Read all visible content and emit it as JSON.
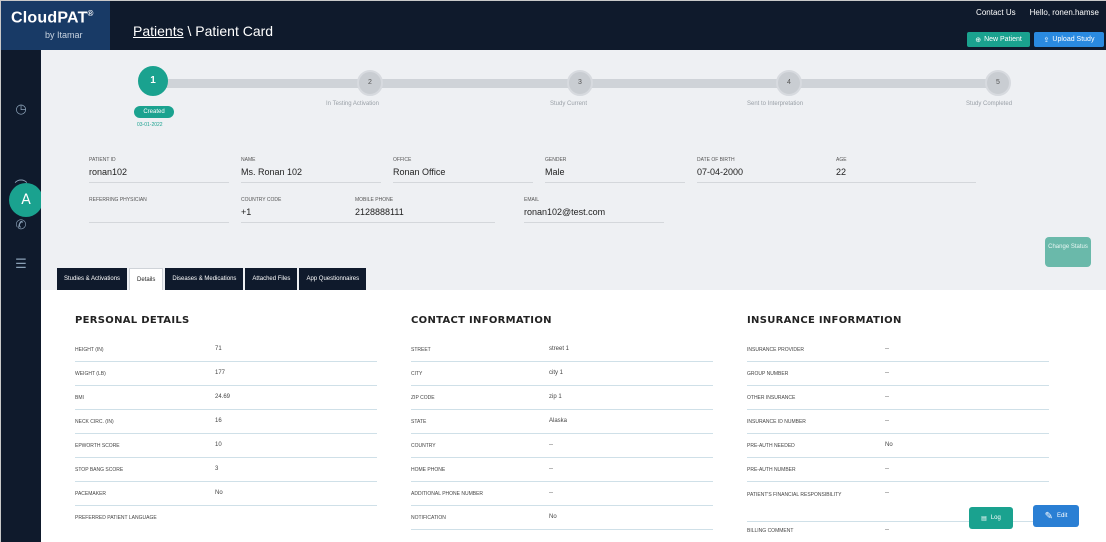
{
  "app": {
    "logo": "CloudPAT",
    "logo_mark": "®",
    "logo_sub": "by Itamar"
  },
  "topbar": {
    "breadcrumb_link": "Patients",
    "breadcrumb_sep": " \\ ",
    "breadcrumb_current": "Patient Card",
    "contact_us": "Contact Us",
    "greeting": "Hello, ronen.hamse",
    "new_patient_label": "New Patient",
    "upload_study_label": "Upload Study"
  },
  "sidebar": {
    "icons": [
      "clock-icon",
      "patient-icon",
      "device-icon",
      "phone-icon",
      "menu-icon"
    ],
    "active_label": "A"
  },
  "stepper": {
    "steps": [
      {
        "number": "1",
        "label": "Created",
        "date": "03-01-2022"
      },
      {
        "number": "2",
        "label": "In Testing Activation"
      },
      {
        "number": "3",
        "label": "Study Current"
      },
      {
        "number": "4",
        "label": "Sent to Interpretation"
      },
      {
        "number": "5",
        "label": "Study Completed"
      }
    ]
  },
  "patient": {
    "fields": [
      {
        "label": "Patient ID",
        "value": "ronan102"
      },
      {
        "label": "Name",
        "value": "Ms. Ronan 102"
      },
      {
        "label": "Office",
        "value": "Ronan Office"
      },
      {
        "label": "Gender",
        "value": "Male"
      },
      {
        "label": "Date of Birth",
        "value": "07-04-2000"
      },
      {
        "label": "Age",
        "value": "22"
      },
      {
        "label": "Referring Physician",
        "value": ""
      },
      {
        "label": "Country Code",
        "value": "+1"
      },
      {
        "label": "Mobile Phone",
        "value": "2128888111"
      },
      {
        "label": "Email",
        "value": "ronan102@test.com"
      }
    ],
    "status_button": "Change Status"
  },
  "tabs": [
    {
      "label": "Studies & Activations",
      "active": false
    },
    {
      "label": "Details",
      "active": true
    },
    {
      "label": "Diseases & Medications",
      "active": false
    },
    {
      "label": "Attached Files",
      "active": false
    },
    {
      "label": "App Questionnaires",
      "active": false
    }
  ],
  "personal_details": {
    "title": "PERSONAL DETAILS",
    "rows": [
      {
        "label": "Height (in)",
        "value": "71"
      },
      {
        "label": "Weight (lb)",
        "value": "177"
      },
      {
        "label": "BMI",
        "value": "24.69"
      },
      {
        "label": "Neck Circ. (in)",
        "value": "16"
      },
      {
        "label": "Epworth Score",
        "value": "10"
      },
      {
        "label": "Stop Bang Score",
        "value": "3"
      },
      {
        "label": "Pacemaker",
        "value": "No"
      },
      {
        "label": "Preferred Patient Language",
        "value": ""
      }
    ]
  },
  "contact_information": {
    "title": "CONTACT INFORMATION",
    "rows": [
      {
        "label": "Street",
        "value": "street 1"
      },
      {
        "label": "City",
        "value": "city 1"
      },
      {
        "label": "Zip Code",
        "value": "zip 1"
      },
      {
        "label": "State",
        "value": "Alaska"
      },
      {
        "label": "Country",
        "value": "--"
      },
      {
        "label": "Home Phone",
        "value": "--"
      },
      {
        "label": "Additional Phone Number",
        "value": "--"
      },
      {
        "label": "Notification",
        "value": "No"
      }
    ]
  },
  "insurance_information": {
    "title": "INSURANCE INFORMATION",
    "rows": [
      {
        "label": "Insurance Provider",
        "value": "--"
      },
      {
        "label": "Group Number",
        "value": "--"
      },
      {
        "label": "Other Insurance",
        "value": "--"
      },
      {
        "label": "Insurance ID Number",
        "value": "--"
      },
      {
        "label": "Pre-Auth Needed",
        "value": "No"
      },
      {
        "label": "Pre-Auth Number",
        "value": "--"
      },
      {
        "label": "Patient's Financial Responsibility",
        "value": "--"
      },
      {
        "label": "Billing Comment",
        "value": "--"
      }
    ]
  },
  "actions": {
    "log_label": "Log",
    "edit_label": "Edit"
  },
  "colors": {
    "primary_teal": "#1aa28f",
    "nav_dark": "#0f1a2c",
    "accent_blue": "#2a7fd4"
  }
}
